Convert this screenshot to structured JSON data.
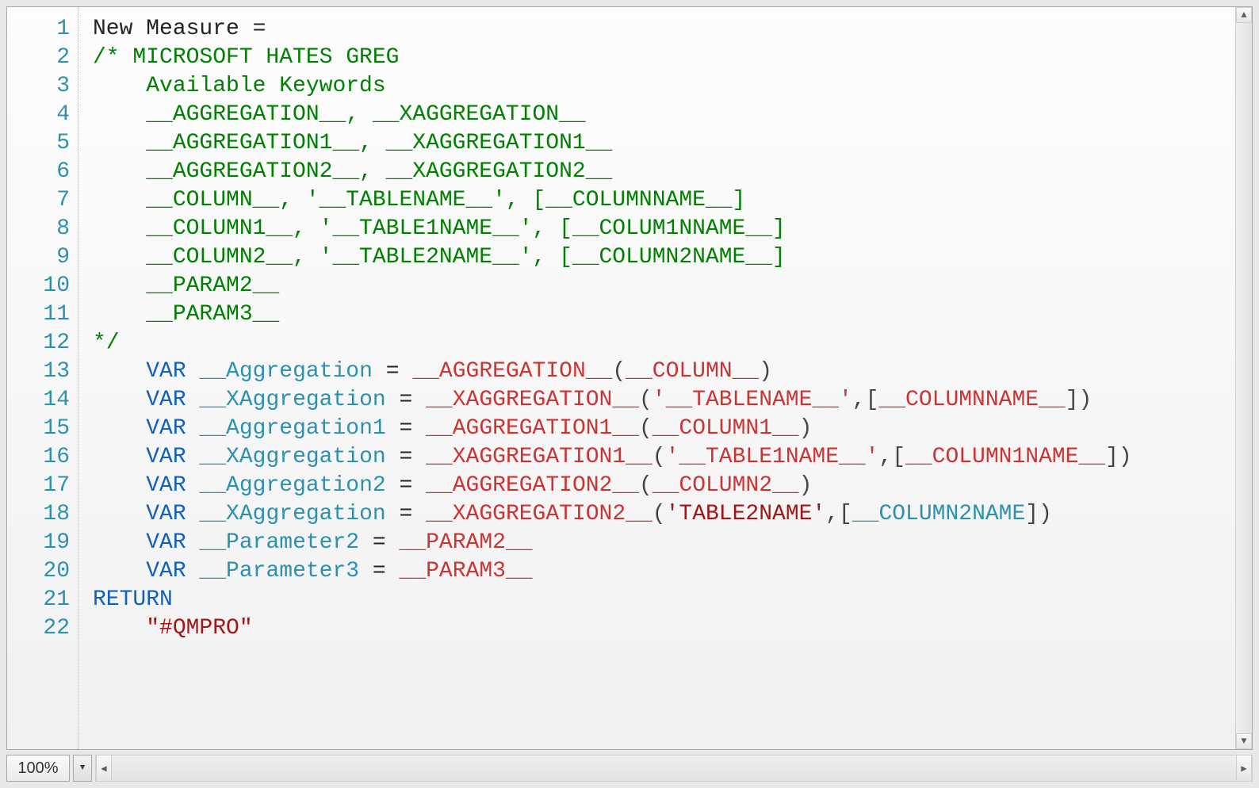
{
  "zoom": "100%",
  "line_count": 22,
  "code": {
    "lines": [
      [
        {
          "cls": "tok-plain",
          "text": "New Measure = "
        }
      ],
      [
        {
          "cls": "tok-comment",
          "text": "/* MICROSOFT HATES GREG"
        }
      ],
      [
        {
          "cls": "tok-comment",
          "text": "    Available Keywords"
        }
      ],
      [
        {
          "cls": "tok-comment",
          "text": "    __AGGREGATION__, __XAGGREGATION__"
        }
      ],
      [
        {
          "cls": "tok-comment",
          "text": "    __AGGREGATION1__, __XAGGREGATION1__"
        }
      ],
      [
        {
          "cls": "tok-comment",
          "text": "    __AGGREGATION2__, __XAGGREGATION2__"
        }
      ],
      [
        {
          "cls": "tok-comment",
          "text": "    __COLUMN__, '__TABLENAME__', [__COLUMNNAME__]"
        }
      ],
      [
        {
          "cls": "tok-comment",
          "text": "    __COLUMN1__, '__TABLE1NAME__', [__COLUM1NNAME__]"
        }
      ],
      [
        {
          "cls": "tok-comment",
          "text": "    __COLUMN2__, '__TABLE2NAME__', [__COLUMN2NAME__]"
        }
      ],
      [
        {
          "cls": "tok-comment",
          "text": "    __PARAM2__"
        }
      ],
      [
        {
          "cls": "tok-comment",
          "text": "    __PARAM3__"
        }
      ],
      [
        {
          "cls": "tok-comment",
          "text": "*/"
        }
      ],
      [
        {
          "cls": "tok-plain",
          "text": "    "
        },
        {
          "cls": "tok-keyword",
          "text": "VAR"
        },
        {
          "cls": "tok-plain",
          "text": " "
        },
        {
          "cls": "tok-var",
          "text": "__Aggregation"
        },
        {
          "cls": "tok-plain",
          "text": " = "
        },
        {
          "cls": "tok-func",
          "text": "__AGGREGATION__"
        },
        {
          "cls": "tok-op",
          "text": "("
        },
        {
          "cls": "tok-func",
          "text": "__COLUMN__"
        },
        {
          "cls": "tok-op",
          "text": ")"
        }
      ],
      [
        {
          "cls": "tok-plain",
          "text": "    "
        },
        {
          "cls": "tok-keyword",
          "text": "VAR"
        },
        {
          "cls": "tok-plain",
          "text": " "
        },
        {
          "cls": "tok-var",
          "text": "__XAggregation"
        },
        {
          "cls": "tok-plain",
          "text": " = "
        },
        {
          "cls": "tok-func",
          "text": "__XAGGREGATION__"
        },
        {
          "cls": "tok-op",
          "text": "("
        },
        {
          "cls": "tok-func",
          "text": "'__TABLENAME__'"
        },
        {
          "cls": "tok-op",
          "text": ",["
        },
        {
          "cls": "tok-func",
          "text": "__COLUMNNAME__"
        },
        {
          "cls": "tok-op",
          "text": "])"
        }
      ],
      [
        {
          "cls": "tok-plain",
          "text": "    "
        },
        {
          "cls": "tok-keyword",
          "text": "VAR"
        },
        {
          "cls": "tok-plain",
          "text": " "
        },
        {
          "cls": "tok-var",
          "text": "__Aggregation1"
        },
        {
          "cls": "tok-plain",
          "text": " = "
        },
        {
          "cls": "tok-func",
          "text": "__AGGREGATION1__"
        },
        {
          "cls": "tok-op",
          "text": "("
        },
        {
          "cls": "tok-func",
          "text": "__COLUMN1__"
        },
        {
          "cls": "tok-op",
          "text": ")"
        }
      ],
      [
        {
          "cls": "tok-plain",
          "text": "    "
        },
        {
          "cls": "tok-keyword",
          "text": "VAR"
        },
        {
          "cls": "tok-plain",
          "text": " "
        },
        {
          "cls": "tok-var",
          "text": "__XAggregation"
        },
        {
          "cls": "tok-plain",
          "text": " = "
        },
        {
          "cls": "tok-func",
          "text": "__XAGGREGATION1__"
        },
        {
          "cls": "tok-op",
          "text": "("
        },
        {
          "cls": "tok-func",
          "text": "'__TABLE1NAME__'"
        },
        {
          "cls": "tok-op",
          "text": ",["
        },
        {
          "cls": "tok-func",
          "text": "__COLUMN1NAME__"
        },
        {
          "cls": "tok-op",
          "text": "])"
        }
      ],
      [
        {
          "cls": "tok-plain",
          "text": "    "
        },
        {
          "cls": "tok-keyword",
          "text": "VAR"
        },
        {
          "cls": "tok-plain",
          "text": " "
        },
        {
          "cls": "tok-var",
          "text": "__Aggregation2"
        },
        {
          "cls": "tok-plain",
          "text": " = "
        },
        {
          "cls": "tok-func",
          "text": "__AGGREGATION2__"
        },
        {
          "cls": "tok-op",
          "text": "("
        },
        {
          "cls": "tok-func",
          "text": "__COLUMN2__"
        },
        {
          "cls": "tok-op",
          "text": ")"
        }
      ],
      [
        {
          "cls": "tok-plain",
          "text": "    "
        },
        {
          "cls": "tok-keyword",
          "text": "VAR"
        },
        {
          "cls": "tok-plain",
          "text": " "
        },
        {
          "cls": "tok-var",
          "text": "__XAggregation"
        },
        {
          "cls": "tok-plain",
          "text": " = "
        },
        {
          "cls": "tok-func",
          "text": "__XAGGREGATION2__"
        },
        {
          "cls": "tok-op",
          "text": "("
        },
        {
          "cls": "tok-string",
          "text": "'TABLE2NAME'"
        },
        {
          "cls": "tok-op",
          "text": ",["
        },
        {
          "cls": "tok-var",
          "text": "__COLUMN2NAME"
        },
        {
          "cls": "tok-op",
          "text": "])"
        }
      ],
      [
        {
          "cls": "tok-plain",
          "text": "    "
        },
        {
          "cls": "tok-keyword",
          "text": "VAR"
        },
        {
          "cls": "tok-plain",
          "text": " "
        },
        {
          "cls": "tok-var",
          "text": "__Parameter2"
        },
        {
          "cls": "tok-plain",
          "text": " = "
        },
        {
          "cls": "tok-func",
          "text": "__PARAM2__"
        }
      ],
      [
        {
          "cls": "tok-plain",
          "text": "    "
        },
        {
          "cls": "tok-keyword",
          "text": "VAR"
        },
        {
          "cls": "tok-plain",
          "text": " "
        },
        {
          "cls": "tok-var",
          "text": "__Parameter3"
        },
        {
          "cls": "tok-plain",
          "text": " = "
        },
        {
          "cls": "tok-func",
          "text": "__PARAM3__"
        }
      ],
      [
        {
          "cls": "tok-keyword",
          "text": "RETURN"
        }
      ],
      [
        {
          "cls": "tok-plain",
          "text": "    "
        },
        {
          "cls": "tok-string",
          "text": "\"#QMPRO\""
        }
      ]
    ]
  }
}
